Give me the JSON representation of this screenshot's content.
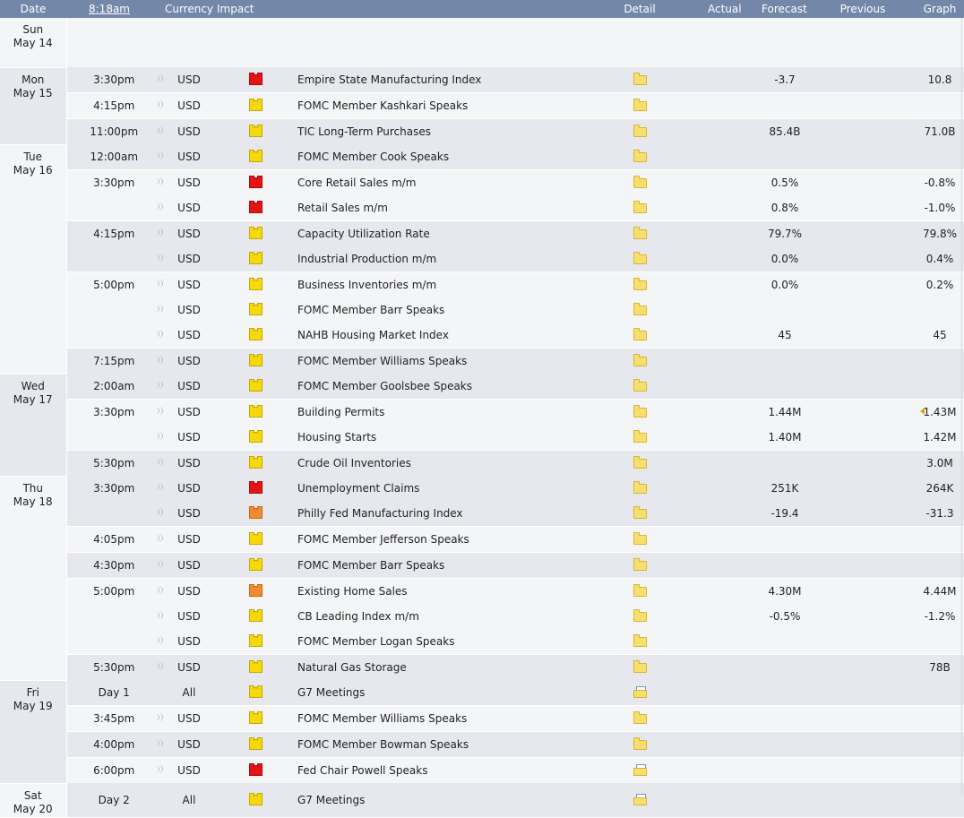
{
  "header": {
    "date": "Date",
    "time": "8:18am",
    "currency": "Currency",
    "impact": "Impact",
    "event": "",
    "detail": "Detail",
    "actual": "Actual",
    "forecast": "Forecast",
    "previous": "Previous",
    "graph": "Graph"
  },
  "colors": {
    "header_bg": "#7387a9",
    "row_dark": "#e6e8ee",
    "row_light": "#f4f5f7",
    "impact_high": "#e51313",
    "impact_medium": "#f08c2e",
    "impact_low": "#f5d90a"
  },
  "icons": {
    "sound": "sound-wave-icon",
    "detail": "folder-icon",
    "detail_doc": "folder-document-icon",
    "graph": "bar-chart-icon",
    "revision": "revision-arrow-icon"
  },
  "days": [
    {
      "day": "Sun",
      "date": "May 14",
      "events": [
        {
          "time": "",
          "currency": "",
          "impact": "none",
          "event": "",
          "forecast": "",
          "previous": "",
          "graph": false,
          "empty": true
        }
      ]
    },
    {
      "day": "Mon",
      "date": "May 15",
      "events": [
        {
          "time": "3:30pm",
          "currency": "USD",
          "impact": "high",
          "event": "Empire State Manufacturing Index",
          "forecast": "-3.7",
          "previous": "10.8",
          "graph": true
        },
        {
          "time": "4:15pm",
          "currency": "USD",
          "impact": "low",
          "event": "FOMC Member Kashkari Speaks",
          "forecast": "",
          "previous": "",
          "graph": false
        },
        {
          "time": "11:00pm",
          "currency": "USD",
          "impact": "low",
          "event": "TIC Long-Term Purchases",
          "forecast": "85.4B",
          "previous": "71.0B",
          "graph": true
        }
      ]
    },
    {
      "day": "Tue",
      "date": "May 16",
      "events": [
        {
          "time": "12:00am",
          "currency": "USD",
          "impact": "low",
          "event": "FOMC Member Cook Speaks",
          "forecast": "",
          "previous": "",
          "graph": false
        },
        {
          "time": "3:30pm",
          "currency": "USD",
          "impact": "high",
          "event": "Core Retail Sales m/m",
          "forecast": "0.5%",
          "previous": "-0.8%",
          "graph": true
        },
        {
          "time": "",
          "currency": "USD",
          "impact": "high",
          "event": "Retail Sales m/m",
          "forecast": "0.8%",
          "previous": "-1.0%",
          "graph": true
        },
        {
          "time": "4:15pm",
          "currency": "USD",
          "impact": "low",
          "event": "Capacity Utilization Rate",
          "forecast": "79.7%",
          "previous": "79.8%",
          "graph": true
        },
        {
          "time": "",
          "currency": "USD",
          "impact": "low",
          "event": "Industrial Production m/m",
          "forecast": "0.0%",
          "previous": "0.4%",
          "graph": true
        },
        {
          "time": "5:00pm",
          "currency": "USD",
          "impact": "low",
          "event": "Business Inventories m/m",
          "forecast": "0.0%",
          "previous": "0.2%",
          "graph": true
        },
        {
          "time": "",
          "currency": "USD",
          "impact": "low",
          "event": "FOMC Member Barr Speaks",
          "forecast": "",
          "previous": "",
          "graph": false
        },
        {
          "time": "",
          "currency": "USD",
          "impact": "low",
          "event": "NAHB Housing Market Index",
          "forecast": "45",
          "previous": "45",
          "graph": true
        },
        {
          "time": "7:15pm",
          "currency": "USD",
          "impact": "low",
          "event": "FOMC Member Williams Speaks",
          "forecast": "",
          "previous": "",
          "graph": false
        }
      ]
    },
    {
      "day": "Wed",
      "date": "May 17",
      "events": [
        {
          "time": "2:00am",
          "currency": "USD",
          "impact": "low",
          "event": "FOMC Member Goolsbee Speaks",
          "forecast": "",
          "previous": "",
          "graph": false
        },
        {
          "time": "3:30pm",
          "currency": "USD",
          "impact": "low",
          "event": "Building Permits",
          "forecast": "1.44M",
          "previous": "1.43M",
          "graph": true,
          "revised": true
        },
        {
          "time": "",
          "currency": "USD",
          "impact": "low",
          "event": "Housing Starts",
          "forecast": "1.40M",
          "previous": "1.42M",
          "graph": true
        },
        {
          "time": "5:30pm",
          "currency": "USD",
          "impact": "low",
          "event": "Crude Oil Inventories",
          "forecast": "",
          "previous": "3.0M",
          "graph": true
        }
      ]
    },
    {
      "day": "Thu",
      "date": "May 18",
      "events": [
        {
          "time": "3:30pm",
          "currency": "USD",
          "impact": "high",
          "event": "Unemployment Claims",
          "forecast": "251K",
          "previous": "264K",
          "graph": true
        },
        {
          "time": "",
          "currency": "USD",
          "impact": "medium",
          "event": "Philly Fed Manufacturing Index",
          "forecast": "-19.4",
          "previous": "-31.3",
          "graph": true
        },
        {
          "time": "4:05pm",
          "currency": "USD",
          "impact": "low",
          "event": "FOMC Member Jefferson Speaks",
          "forecast": "",
          "previous": "",
          "graph": false
        },
        {
          "time": "4:30pm",
          "currency": "USD",
          "impact": "low",
          "event": "FOMC Member Barr Speaks",
          "forecast": "",
          "previous": "",
          "graph": false
        },
        {
          "time": "5:00pm",
          "currency": "USD",
          "impact": "medium",
          "event": "Existing Home Sales",
          "forecast": "4.30M",
          "previous": "4.44M",
          "graph": true
        },
        {
          "time": "",
          "currency": "USD",
          "impact": "low",
          "event": "CB Leading Index m/m",
          "forecast": "-0.5%",
          "previous": "-1.2%",
          "graph": false
        },
        {
          "time": "",
          "currency": "USD",
          "impact": "low",
          "event": "FOMC Member Logan Speaks",
          "forecast": "",
          "previous": "",
          "graph": false
        },
        {
          "time": "5:30pm",
          "currency": "USD",
          "impact": "low",
          "event": "Natural Gas Storage",
          "forecast": "",
          "previous": "78B",
          "graph": true
        }
      ]
    },
    {
      "day": "Fri",
      "date": "May 19",
      "events": [
        {
          "time": "Day 1",
          "currency": "All",
          "impact": "low",
          "event": "G7 Meetings",
          "forecast": "",
          "previous": "",
          "graph": false,
          "detail_doc": true,
          "no_sound": true
        },
        {
          "time": "3:45pm",
          "currency": "USD",
          "impact": "low",
          "event": "FOMC Member Williams Speaks",
          "forecast": "",
          "previous": "",
          "graph": false
        },
        {
          "time": "4:00pm",
          "currency": "USD",
          "impact": "low",
          "event": "FOMC Member Bowman Speaks",
          "forecast": "",
          "previous": "",
          "graph": false
        },
        {
          "time": "6:00pm",
          "currency": "USD",
          "impact": "high",
          "event": "Fed Chair Powell Speaks",
          "forecast": "",
          "previous": "",
          "graph": false,
          "detail_doc": true
        }
      ]
    },
    {
      "day": "Sat",
      "date": "May 20",
      "events": [
        {
          "time": "Day 2",
          "currency": "All",
          "impact": "low",
          "event": "G7 Meetings",
          "forecast": "",
          "previous": "",
          "graph": false,
          "detail_doc": true,
          "no_sound": true,
          "tall": true
        }
      ]
    }
  ]
}
